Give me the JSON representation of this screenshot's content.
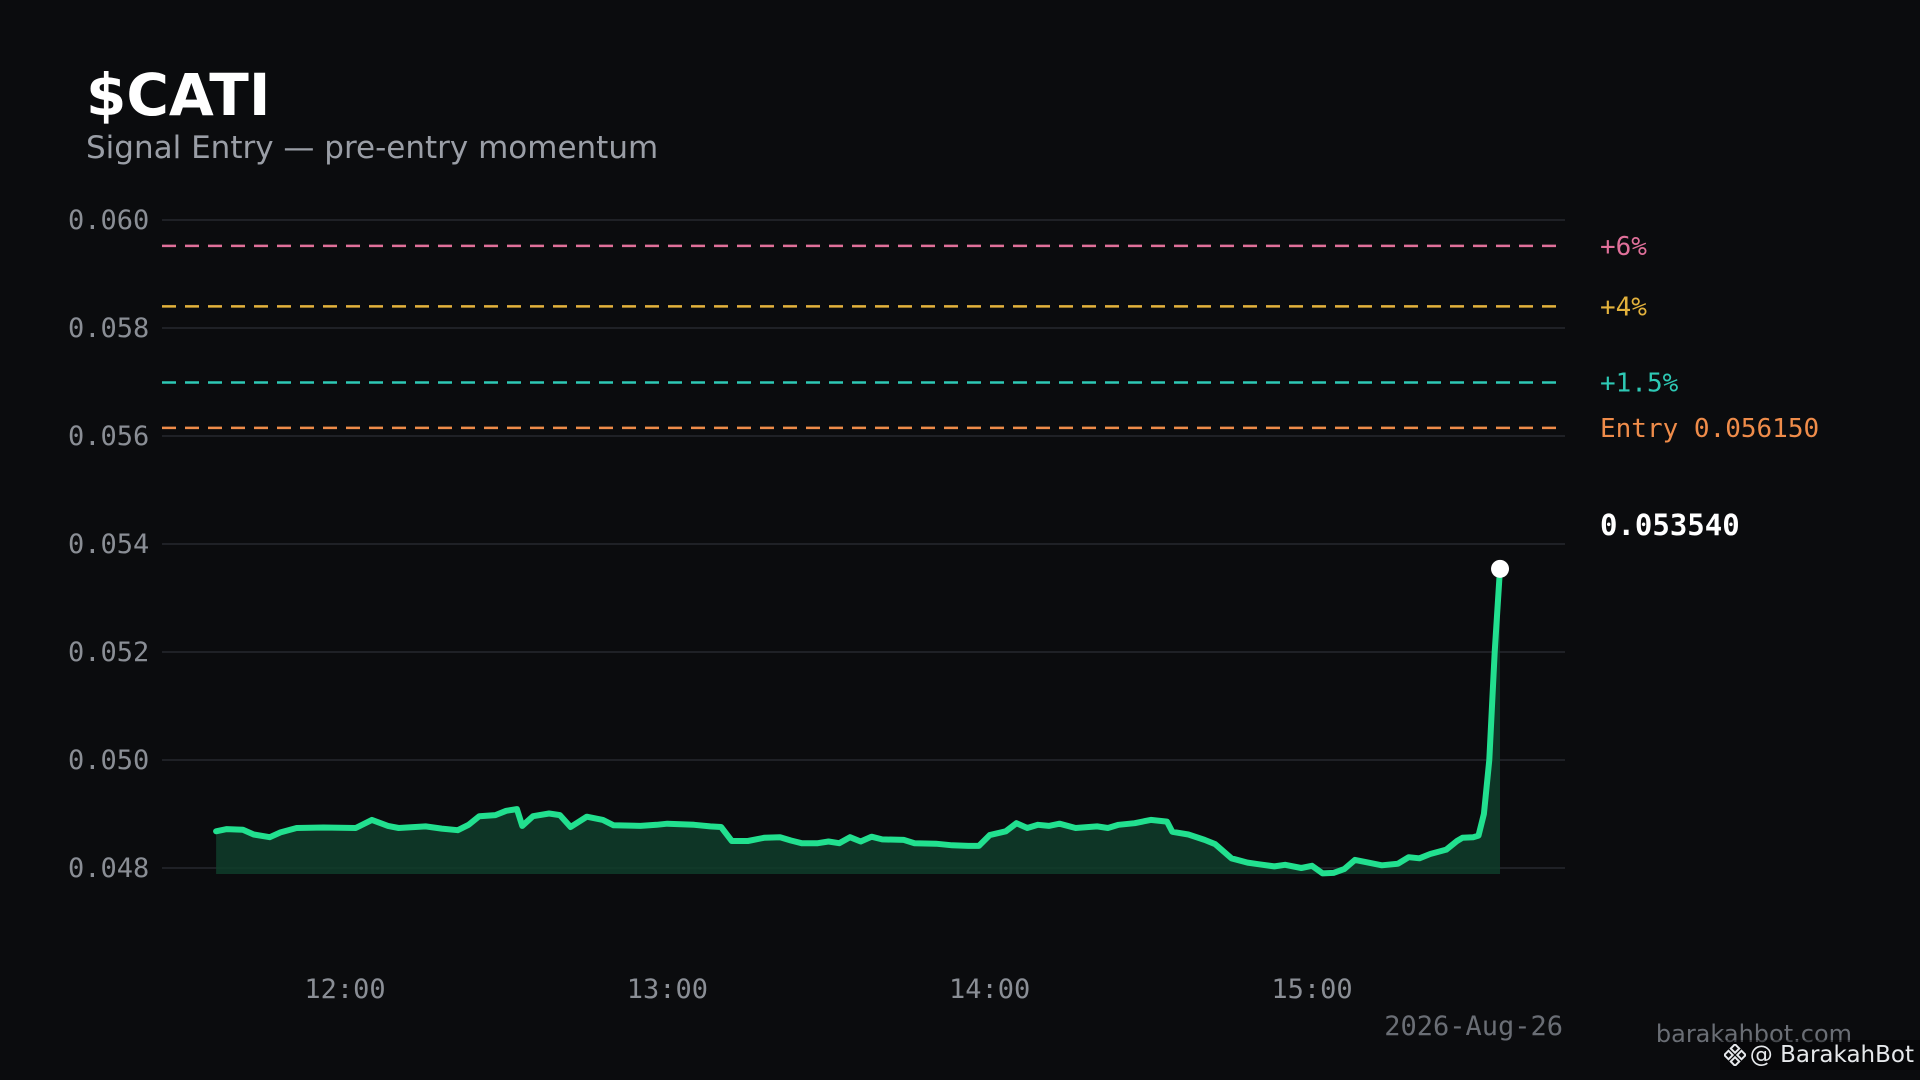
{
  "header": {
    "title": "$CATI",
    "subtitle": "Signal Entry — pre-entry momentum"
  },
  "footer": {
    "date": "2026-Aug-26",
    "site": "barakahbot.com",
    "handle": "@ BarakahBot",
    "handle_icon": "binance-logo-icon"
  },
  "colors": {
    "background": "#0b0c0e",
    "price_line": "#22e08f",
    "price_fill": "#0f3d2a",
    "grid": "#1f2126",
    "tick": "#8a8e95",
    "target_6": "#e0709a",
    "target_4": "#e3b23c",
    "target_1_5": "#2ec9b5",
    "entry": "#ef8c4a",
    "current": "#ffffff"
  },
  "chart_data": {
    "type": "line",
    "title": "$CATI",
    "subtitle": "Signal Entry — pre-entry momentum",
    "xlabel": "",
    "ylabel": "",
    "x_range": [
      "11:36",
      "15:35"
    ],
    "ylim": [
      0.047,
      0.06
    ],
    "yticks": [
      {
        "value": 0.06,
        "label": "0.060"
      },
      {
        "value": 0.058,
        "label": "0.058"
      },
      {
        "value": 0.056,
        "label": "0.056"
      },
      {
        "value": 0.054,
        "label": "0.054"
      },
      {
        "value": 0.052,
        "label": "0.052"
      },
      {
        "value": 0.05,
        "label": "0.050"
      },
      {
        "value": 0.048,
        "label": "0.048"
      }
    ],
    "xticks": [
      {
        "value": "12:00",
        "label": "12:00"
      },
      {
        "value": "13:00",
        "label": "13:00"
      },
      {
        "value": "14:00",
        "label": "14:00"
      },
      {
        "value": "15:00",
        "label": "15:00"
      }
    ],
    "grid": true,
    "levels": [
      {
        "label": "+6%",
        "value": 0.05952,
        "color_key": "target_6"
      },
      {
        "label": "+4%",
        "value": 0.0584,
        "color_key": "target_4"
      },
      {
        "label": "+1.5%",
        "value": 0.05699,
        "color_key": "target_1_5"
      },
      {
        "label": "Entry 0.056150",
        "value": 0.05615,
        "color_key": "entry"
      }
    ],
    "current": {
      "label": "0.053540",
      "time": "15:35",
      "value": 0.05354
    },
    "series": [
      {
        "points": [
          [
            "11:36",
            0.04868
          ],
          [
            "11:38",
            0.04872
          ],
          [
            "11:41",
            0.04871
          ],
          [
            "11:43",
            0.04862
          ],
          [
            "11:46",
            0.04857
          ],
          [
            "11:48",
            0.04866
          ],
          [
            "11:51",
            0.04874
          ],
          [
            "11:56",
            0.04875
          ],
          [
            "12:02",
            0.04874
          ],
          [
            "12:05",
            0.04889
          ],
          [
            "12:08",
            0.04878
          ],
          [
            "12:10",
            0.04874
          ],
          [
            "12:15",
            0.04877
          ],
          [
            "12:18",
            0.04873
          ],
          [
            "12:21",
            0.0487
          ],
          [
            "12:23",
            0.0488
          ],
          [
            "12:25",
            0.04896
          ],
          [
            "12:28",
            0.04898
          ],
          [
            "12:30",
            0.04906
          ],
          [
            "12:32",
            0.04909
          ],
          [
            "12:33",
            0.04878
          ],
          [
            "12:35",
            0.04896
          ],
          [
            "12:38",
            0.04901
          ],
          [
            "12:40",
            0.04898
          ],
          [
            "12:42",
            0.04876
          ],
          [
            "12:45",
            0.04895
          ],
          [
            "12:48",
            0.04889
          ],
          [
            "12:50",
            0.04879
          ],
          [
            "12:55",
            0.04878
          ],
          [
            "12:58",
            0.0488
          ],
          [
            "13:00",
            0.04882
          ],
          [
            "13:05",
            0.0488
          ],
          [
            "13:08",
            0.04877
          ],
          [
            "13:10",
            0.04876
          ],
          [
            "13:12",
            0.0485
          ],
          [
            "13:15",
            0.0485
          ],
          [
            "13:18",
            0.04856
          ],
          [
            "13:21",
            0.04857
          ],
          [
            "13:23",
            0.04851
          ],
          [
            "13:25",
            0.04846
          ],
          [
            "13:28",
            0.04846
          ],
          [
            "13:30",
            0.04849
          ],
          [
            "13:32",
            0.04846
          ],
          [
            "13:34",
            0.04857
          ],
          [
            "13:36",
            0.04849
          ],
          [
            "13:38",
            0.04858
          ],
          [
            "13:40",
            0.04853
          ],
          [
            "13:44",
            0.04852
          ],
          [
            "13:46",
            0.04846
          ],
          [
            "13:50",
            0.04845
          ],
          [
            "13:53",
            0.04842
          ],
          [
            "13:56",
            0.04841
          ],
          [
            "13:58",
            0.04841
          ],
          [
            "14:00",
            0.04861
          ],
          [
            "14:03",
            0.04868
          ],
          [
            "14:05",
            0.04883
          ],
          [
            "14:07",
            0.04874
          ],
          [
            "14:09",
            0.0488
          ],
          [
            "14:11",
            0.04878
          ],
          [
            "14:13",
            0.04882
          ],
          [
            "14:16",
            0.04874
          ],
          [
            "14:20",
            0.04877
          ],
          [
            "14:22",
            0.04874
          ],
          [
            "14:24",
            0.0488
          ],
          [
            "14:27",
            0.04883
          ],
          [
            "14:30",
            0.04889
          ],
          [
            "14:33",
            0.04886
          ],
          [
            "14:34",
            0.04867
          ],
          [
            "14:37",
            0.04862
          ],
          [
            "14:40",
            0.04852
          ],
          [
            "14:42",
            0.04844
          ],
          [
            "14:45",
            0.04818
          ],
          [
            "14:48",
            0.0481
          ],
          [
            "14:50",
            0.04807
          ],
          [
            "14:53",
            0.04803
          ],
          [
            "14:55",
            0.04806
          ],
          [
            "14:58",
            0.048
          ],
          [
            "15:00",
            0.04804
          ],
          [
            "15:02",
            0.0479
          ],
          [
            "15:04",
            0.04791
          ],
          [
            "15:06",
            0.04798
          ],
          [
            "15:08",
            0.04815
          ],
          [
            "15:10",
            0.04811
          ],
          [
            "15:13",
            0.04805
          ],
          [
            "15:16",
            0.04808
          ],
          [
            "15:18",
            0.0482
          ],
          [
            "15:20",
            0.04818
          ],
          [
            "15:22",
            0.04826
          ],
          [
            "15:25",
            0.04834
          ],
          [
            "15:27",
            0.0485
          ],
          [
            "15:28",
            0.04856
          ],
          [
            "15:30",
            0.04857
          ],
          [
            "15:31",
            0.0486
          ],
          [
            "15:32",
            0.049
          ],
          [
            "15:33",
            0.05
          ],
          [
            "15:34",
            0.052
          ],
          [
            "15:35",
            0.05354
          ]
        ]
      }
    ]
  }
}
